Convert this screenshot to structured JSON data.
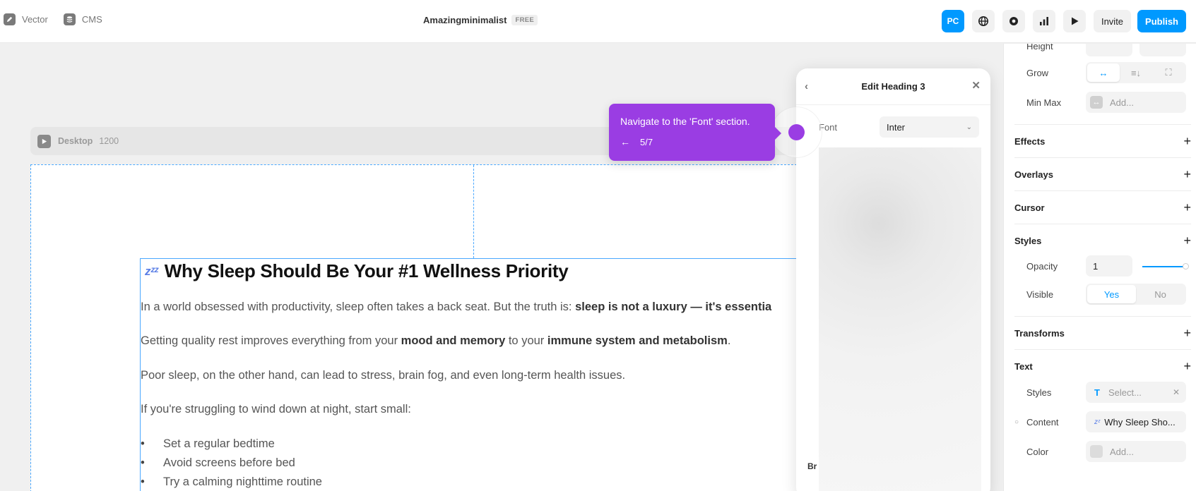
{
  "topbar": {
    "left_items": [
      {
        "label": "Vector",
        "icon": "pen-icon"
      },
      {
        "label": "CMS",
        "icon": "database-icon"
      }
    ],
    "project_name": "Amazingminimalist",
    "plan_badge": "FREE",
    "device_button": "PC",
    "invite_label": "Invite",
    "publish_label": "Publish",
    "accent_color": "#0099ff"
  },
  "canvas": {
    "breakpoint_name": "Desktop",
    "breakpoint_width": "1200",
    "article": {
      "emoji": "💤",
      "title": "Why Sleep Should Be Your #1 Wellness Priority",
      "p1_text": "In a world obsessed with productivity, sleep often takes a back seat. But the truth is: ",
      "p1_bold": "sleep is not a luxury — it's essentia",
      "p2_text_a": "Getting quality rest improves everything from your ",
      "p2_bold_a": "mood and memory",
      "p2_text_b": " to your ",
      "p2_bold_b": "immune system and metabolism",
      "p2_text_c": ".",
      "p3": "Poor sleep, on the other hand, can lead to stress, brain fog, and even long-term health issues.",
      "p4": "If you're struggling to wind down at night, start small:",
      "bullets": [
        "Set a regular bedtime",
        "Avoid screens before bed",
        "Try a calming nighttime routine"
      ]
    }
  },
  "edit_panel": {
    "title": "Edit Heading 3",
    "font_label": "Font",
    "font_value": "Inter",
    "truncated_label": "Br"
  },
  "tooltip": {
    "text": "Navigate to the 'Font' section.",
    "step": "5/7",
    "color": "#9a3de3"
  },
  "props": {
    "height_label": "Height",
    "grow_label": "Grow",
    "minmax_label": "Min Max",
    "minmax_placeholder": "Add...",
    "effects": "Effects",
    "overlays": "Overlays",
    "cursor": "Cursor",
    "styles_section": "Styles",
    "opacity_label": "Opacity",
    "opacity_value": "1",
    "visible_label": "Visible",
    "visible_yes": "Yes",
    "visible_no": "No",
    "transforms": "Transforms",
    "text_section": "Text",
    "text_styles_label": "Styles",
    "text_styles_placeholder": "Select...",
    "content_label": "Content",
    "content_value": "Why Sleep Sho...",
    "color_label": "Color",
    "color_placeholder": "Add..."
  }
}
